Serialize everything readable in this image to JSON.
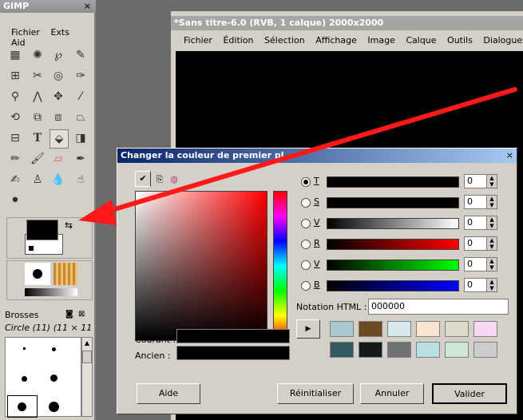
{
  "toolbox": {
    "title": "GIMP",
    "close": "×",
    "menu": [
      "Fichier",
      "Exts",
      "Aid"
    ],
    "brushes_title": "Brosses",
    "brush_name": "Circle (11) (11 × 11"
  },
  "image_window": {
    "title": "*Sans titre-6.0 (RVB, 1 calque) 2000x2000",
    "menu": [
      "Fichier",
      "Édition",
      "Sélection",
      "Affichage",
      "Image",
      "Calque",
      "Outils",
      "Dialogues"
    ]
  },
  "dialog": {
    "title": "Changer la couleur de premier pl",
    "close": "×",
    "channels": [
      {
        "label": "T",
        "value": "0",
        "selected": true,
        "gradient": "linear-gradient(90deg,#000,#000)"
      },
      {
        "label": "S",
        "value": "0",
        "selected": false,
        "gradient": "linear-gradient(90deg,#000,#000)"
      },
      {
        "label": "V",
        "value": "0",
        "selected": false,
        "gradient": "linear-gradient(90deg,#000,#fff)"
      },
      {
        "label": "R",
        "value": "0",
        "selected": false,
        "gradient": "linear-gradient(90deg,#000,#ff0000)"
      },
      {
        "label": "V",
        "value": "0",
        "selected": false,
        "gradient": "linear-gradient(90deg,#000,#00ff00)"
      },
      {
        "label": "B",
        "value": "0",
        "selected": false,
        "gradient": "linear-gradient(90deg,#000,#0000ff)"
      }
    ],
    "html_label": "Notation HTML :",
    "html_value": "000000",
    "current_label": "Courant :",
    "old_label": "Ancien :",
    "history_colors": [
      [
        "#a9c9cf",
        "#6b4a24",
        "#d8e8ec",
        "#f9e6d0",
        "#dcdcc8",
        "#f7d8f2"
      ],
      [
        "#335a5f",
        "#141a1a",
        "#6e7372",
        "#b8e0e2",
        "#cfe8d6",
        "#cccccc"
      ]
    ],
    "buttons": {
      "help": "Aide",
      "reset": "Réinitialiser",
      "cancel": "Annuler",
      "ok": "Valider"
    }
  }
}
